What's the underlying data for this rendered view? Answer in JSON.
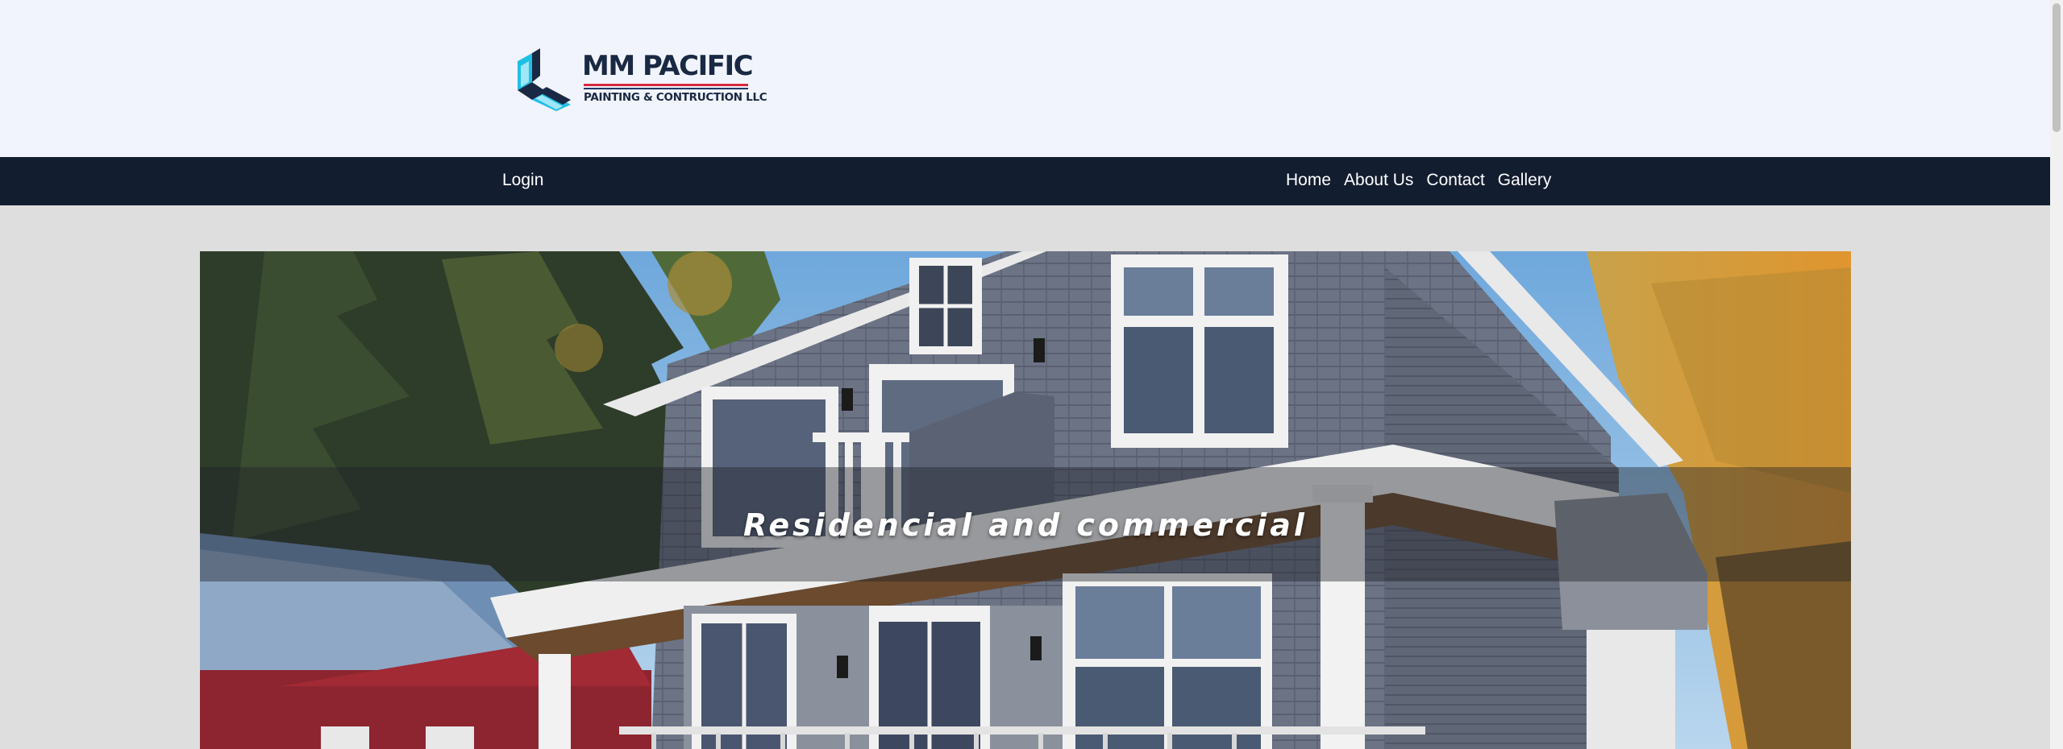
{
  "brand": {
    "name": "MM PACIFIC",
    "tagline": "PAINTING & CONTRUCTION LLC",
    "colors": {
      "navy": "#1a2943",
      "cyan": "#1fc0e6",
      "red": "#d6283c"
    }
  },
  "nav": {
    "login_label": "Login",
    "links": [
      "Home",
      "About Us",
      "Contact",
      "Gallery"
    ],
    "background": "#131d30"
  },
  "hero": {
    "caption": "Residencial and commercial",
    "image": "house-photo"
  }
}
